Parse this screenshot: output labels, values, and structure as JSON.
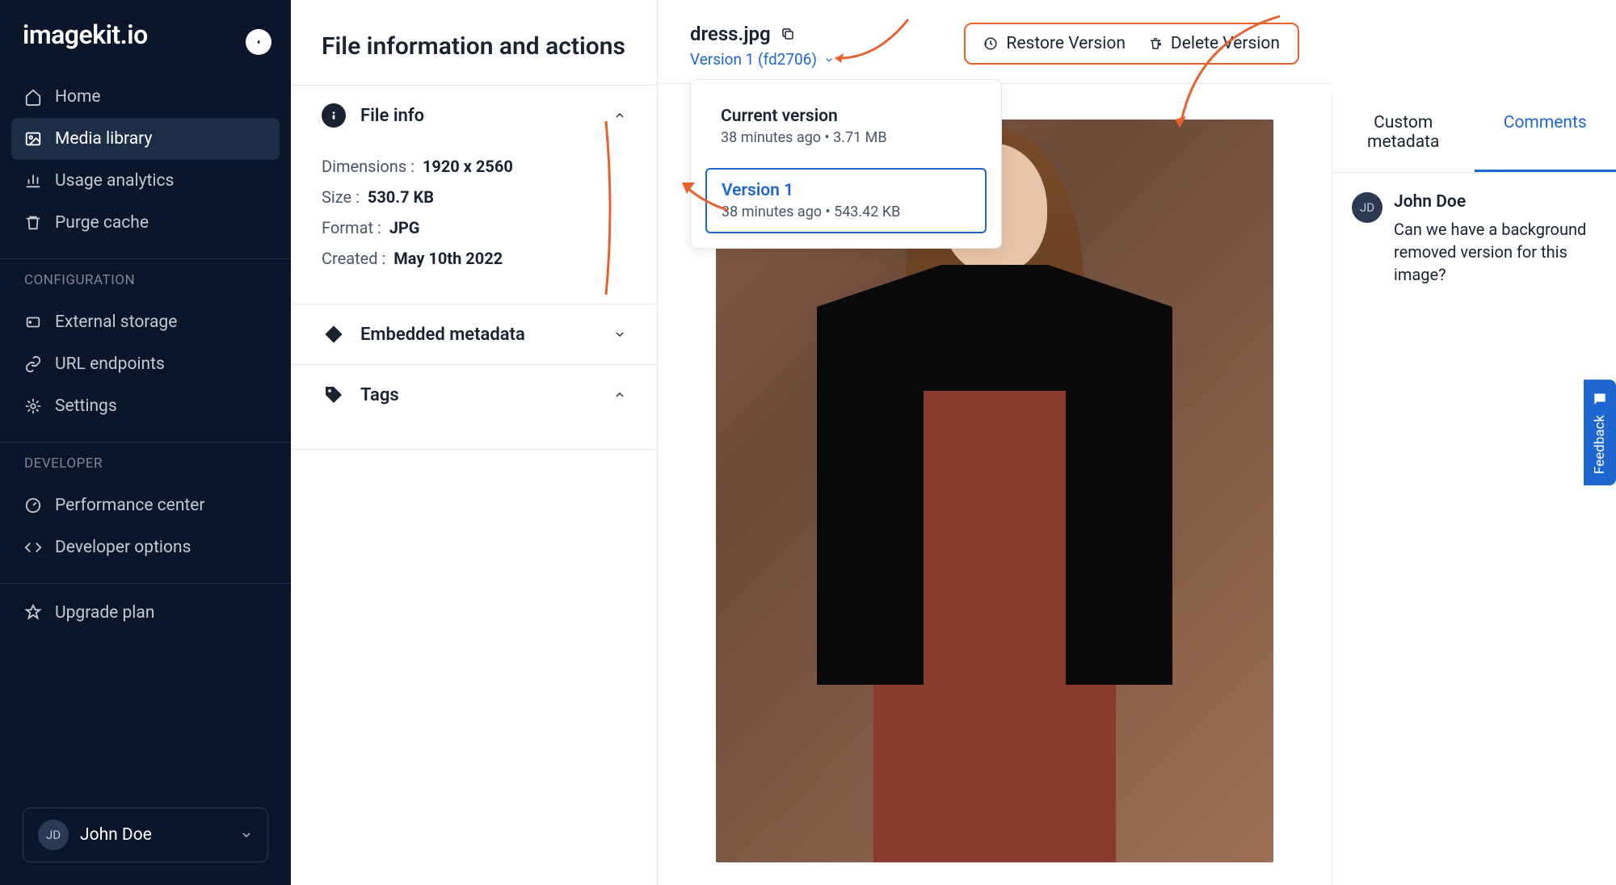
{
  "app": {
    "name": "imagekit.io"
  },
  "sidebar": {
    "items": [
      {
        "label": "Home"
      },
      {
        "label": "Media library"
      },
      {
        "label": "Usage analytics"
      },
      {
        "label": "Purge cache"
      }
    ],
    "section_config": "CONFIGURATION",
    "config_items": [
      {
        "label": "External storage"
      },
      {
        "label": "URL endpoints"
      },
      {
        "label": "Settings"
      }
    ],
    "section_dev": "DEVELOPER",
    "dev_items": [
      {
        "label": "Performance center"
      },
      {
        "label": "Developer options"
      }
    ],
    "upgrade": "Upgrade plan",
    "user": {
      "initials": "JD",
      "name": "John Doe"
    }
  },
  "info_panel": {
    "title": "File information and actions",
    "sections": {
      "file_info": {
        "title": "File info",
        "dimensions_label": "Dimensions :",
        "dimensions_value": "1920 x 2560",
        "size_label": "Size :",
        "size_value": "530.7 KB",
        "format_label": "Format :",
        "format_value": "JPG",
        "created_label": "Created :",
        "created_value": "May 10th 2022"
      },
      "embedded": {
        "title": "Embedded metadata"
      },
      "tags": {
        "title": "Tags"
      }
    }
  },
  "viewer": {
    "file_name": "dress.jpg",
    "version_selector": "Version 1 (fd2706)",
    "restore_label": "Restore Version",
    "delete_label": "Delete Version",
    "versions": [
      {
        "title": "Current version",
        "meta": "38 minutes ago • 3.71 MB"
      },
      {
        "title": "Version 1",
        "meta": "38 minutes ago • 543.42 KB"
      }
    ]
  },
  "right_panel": {
    "tab_custom": "Custom metadata",
    "tab_comments": "Comments",
    "comment": {
      "initials": "JD",
      "author": "John Doe",
      "text": "Can we have a background removed version for this image?"
    }
  },
  "feedback": "Feedback"
}
